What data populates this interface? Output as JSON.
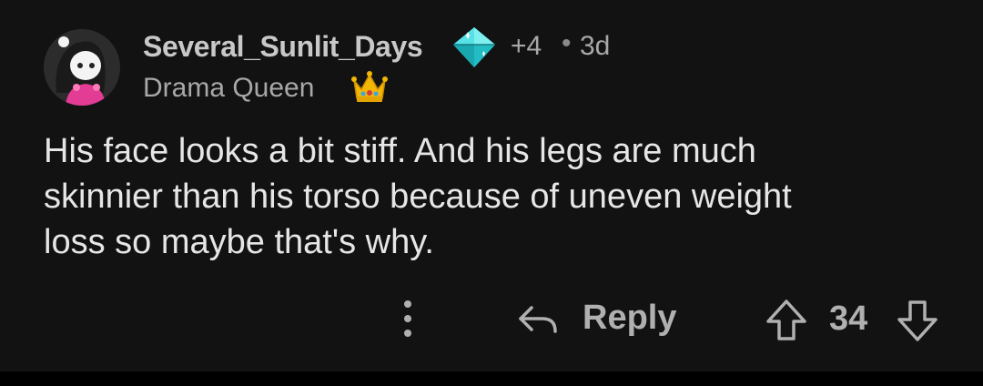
{
  "comment": {
    "author": "Several_Sunlit_Days",
    "award_icon": "diamond-award-icon",
    "award_count": "+4",
    "separator": "•",
    "age": "3d",
    "flair_text": "Drama Queen",
    "flair_icon": "crown-icon",
    "body_line_1": "His face looks a bit stiff. And his legs are much",
    "body_line_2": "skinnier than his torso because of uneven weight",
    "body_line_3": "loss so maybe that's why.",
    "reply_label": "Reply",
    "score": "34"
  },
  "colors": {
    "background": "#121212",
    "text_primary": "#e6e6e6",
    "text_secondary": "#a8a8a8",
    "award_cyan": "#35d6d6",
    "crown_gold": "#f2b705"
  }
}
